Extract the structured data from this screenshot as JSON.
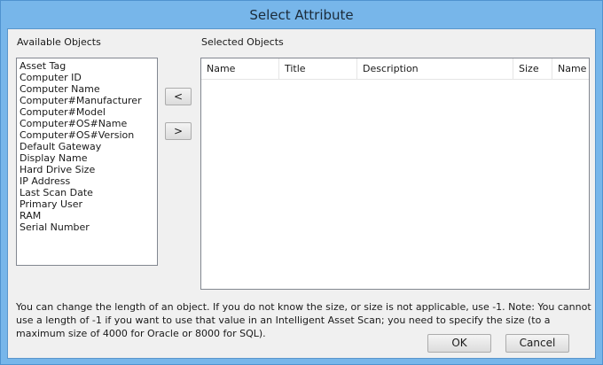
{
  "window": {
    "title": "Select Attribute"
  },
  "available": {
    "label": "Available Objects",
    "items": [
      "Asset Tag",
      "Computer ID",
      "Computer Name",
      "Computer#Manufacturer",
      "Computer#Model",
      "Computer#OS#Name",
      "Computer#OS#Version",
      "Default Gateway",
      "Display Name",
      "Hard Drive Size",
      "IP Address",
      "Last Scan Date",
      "Primary User",
      "RAM",
      "Serial Number"
    ]
  },
  "move": {
    "left_label": "<",
    "right_label": ">"
  },
  "selected": {
    "label": "Selected Objects",
    "columns": [
      "Name",
      "Title",
      "Description",
      "Size",
      "Name"
    ]
  },
  "note": "You can change the length of an object. If you do not know the size, or size is not applicable, use -1. Note: You cannot use a length of -1 if you want to use that value in an Intelligent Asset Scan; you need to specify the size (to a maximum size of 4000 for Oracle or 8000 for SQL).",
  "buttons": {
    "ok": "OK",
    "cancel": "Cancel"
  }
}
